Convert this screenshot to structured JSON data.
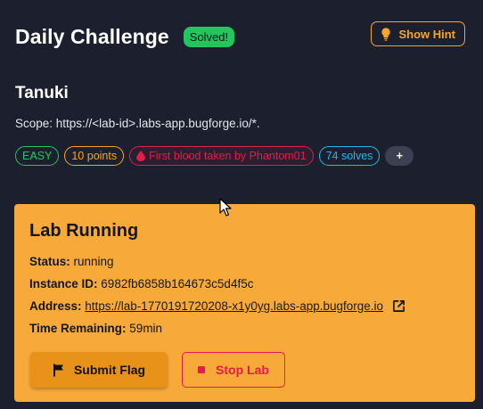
{
  "header": {
    "title": "Daily Challenge",
    "solved_badge": "Solved!",
    "hint_button": "Show Hint"
  },
  "lab": {
    "name": "Tanuki",
    "scope": "Scope: https://<lab-id>.labs-app.bugforge.io/*."
  },
  "tags": {
    "difficulty": "EASY",
    "points": "10 points",
    "first_blood": "First blood taken by Phantom01",
    "solves": "74 solves",
    "more": "+"
  },
  "lab_status": {
    "title": "Lab Running",
    "status_label": "Status:",
    "status_value": "running",
    "instance_label": "Instance ID:",
    "instance_value": "6982fb6858b164673c5d4f5c",
    "address_label": "Address:",
    "address_value": "https://lab-1770191720208-x1y0yg.labs-app.bugforge.io",
    "time_label": "Time Remaining:",
    "time_value": "59min",
    "submit_button": "Submit Flag",
    "stop_button": "Stop Lab"
  },
  "icons": {
    "hint": "lightbulb-icon",
    "first_blood": "blood-drop-icon",
    "address_open": "external-link-icon",
    "submit": "flag-icon",
    "stop": "stop-icon"
  },
  "colors": {
    "background": "#1b1f2e",
    "accent_orange": "#f5a623",
    "card_orange": "#f7a93a",
    "success_green": "#22c55e",
    "danger_red": "#e11d48",
    "info_cyan": "#22b8e6"
  }
}
